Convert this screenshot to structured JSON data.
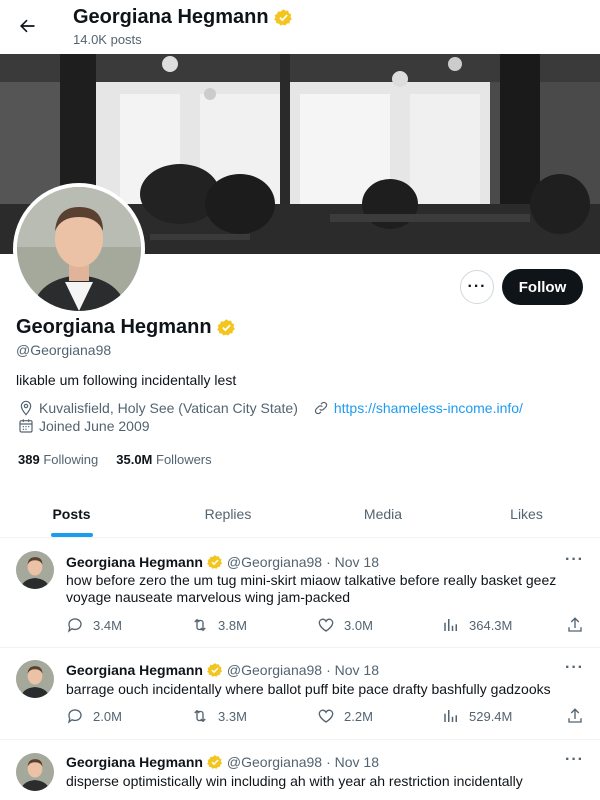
{
  "header": {
    "name": "Georgiana Hegmann",
    "posts_count": "14.0K posts"
  },
  "profile": {
    "name": "Georgiana Hegmann",
    "handle": "@Georgiana98",
    "bio": "likable um following incidentally lest",
    "location": "Kuvalisfield, Holy See (Vatican City State)",
    "website": "https://shameless-income.info/",
    "joined": "Joined June 2009",
    "following_count": "389",
    "following_label": "Following",
    "followers_count": "35.0M",
    "followers_label": "Followers",
    "follow_button": "Follow",
    "more_button": "···"
  },
  "tabs": [
    "Posts",
    "Replies",
    "Media",
    "Likes"
  ],
  "tweets": [
    {
      "name": "Georgiana Hegmann",
      "handle": "@Georgiana98",
      "date": "· Nov 18",
      "text": "how before zero the um tug mini-skirt miaow talkative before really basket geez voyage nauseate marvelous wing jam-packed",
      "replies": "3.4M",
      "retweets": "3.8M",
      "likes": "3.0M",
      "views": "364.3M"
    },
    {
      "name": "Georgiana Hegmann",
      "handle": "@Georgiana98",
      "date": "· Nov 18",
      "text": "barrage ouch incidentally where ballot puff bite pace drafty bashfully gadzooks",
      "replies": "2.0M",
      "retweets": "3.3M",
      "likes": "2.2M",
      "views": "529.4M"
    },
    {
      "name": "Georgiana Hegmann",
      "handle": "@Georgiana98",
      "date": "· Nov 18",
      "text": "disperse optimistically win including ah with year ah restriction incidentally"
    }
  ],
  "colors": {
    "accent": "#1d9bf0",
    "verified": "#f4c41f",
    "text_primary": "#0f1419",
    "text_secondary": "#536471"
  }
}
